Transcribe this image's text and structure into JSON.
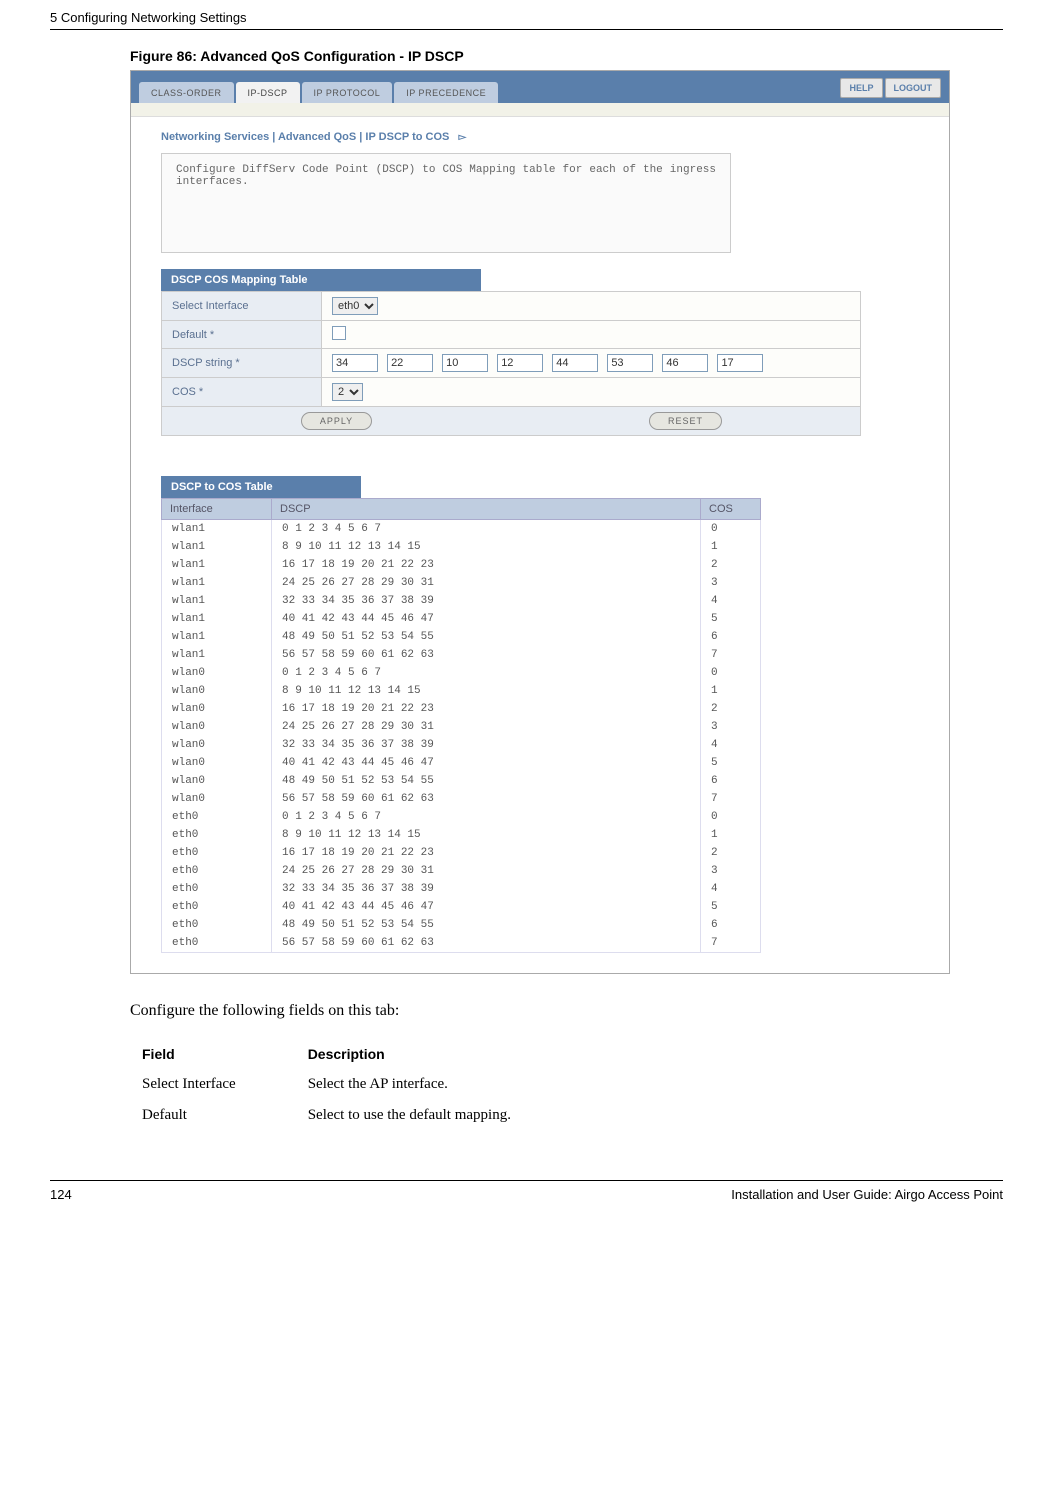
{
  "header": {
    "chapter": "5  Configuring Networking Settings"
  },
  "figure": {
    "caption": "Figure 86:     Advanced QoS Configuration - IP DSCP"
  },
  "ui": {
    "tabs": [
      "CLASS-ORDER",
      "IP-DSCP",
      "IP PROTOCOL",
      "IP PRECEDENCE"
    ],
    "active_tab_index": 1,
    "buttons": {
      "help": "HELP",
      "logout": "LOGOUT"
    },
    "breadcrumb": "Networking Services | Advanced QoS | IP DSCP to COS",
    "info_text": "Configure DiffServ Code Point (DSCP) to COS Mapping table for each of the ingress interfaces.",
    "panel1": {
      "title": "DSCP COS Mapping Table",
      "rows": {
        "select_interface": {
          "label": "Select Interface",
          "value": "eth0"
        },
        "default": {
          "label": "Default *",
          "checked": false
        },
        "dscp_string": {
          "label": "DSCP string *",
          "values": [
            "34",
            "22",
            "10",
            "12",
            "44",
            "53",
            "46",
            "17"
          ]
        },
        "cos": {
          "label": "COS *",
          "value": "2"
        }
      },
      "buttons": {
        "apply": "APPLY",
        "reset": "RESET"
      }
    },
    "panel2": {
      "title": "DSCP to COS Table",
      "headers": [
        "Interface",
        "DSCP",
        "COS"
      ],
      "rows": [
        {
          "iface": "wlan1",
          "dscp": "0 1 2 3 4 5 6 7",
          "cos": "0"
        },
        {
          "iface": "wlan1",
          "dscp": "8 9 10 11 12 13 14 15",
          "cos": "1"
        },
        {
          "iface": "wlan1",
          "dscp": "16 17 18 19 20 21 22 23",
          "cos": "2"
        },
        {
          "iface": "wlan1",
          "dscp": "24 25 26 27 28 29 30 31",
          "cos": "3"
        },
        {
          "iface": "wlan1",
          "dscp": "32 33 34 35 36 37 38 39",
          "cos": "4"
        },
        {
          "iface": "wlan1",
          "dscp": "40 41 42 43 44 45 46 47",
          "cos": "5"
        },
        {
          "iface": "wlan1",
          "dscp": "48 49 50 51 52 53 54 55",
          "cos": "6"
        },
        {
          "iface": "wlan1",
          "dscp": "56 57 58 59 60 61 62 63",
          "cos": "7"
        },
        {
          "iface": "wlan0",
          "dscp": "0 1 2 3 4 5 6 7",
          "cos": "0"
        },
        {
          "iface": "wlan0",
          "dscp": "8 9 10 11 12 13 14 15",
          "cos": "1"
        },
        {
          "iface": "wlan0",
          "dscp": "16 17 18 19 20 21 22 23",
          "cos": "2"
        },
        {
          "iface": "wlan0",
          "dscp": "24 25 26 27 28 29 30 31",
          "cos": "3"
        },
        {
          "iface": "wlan0",
          "dscp": "32 33 34 35 36 37 38 39",
          "cos": "4"
        },
        {
          "iface": "wlan0",
          "dscp": "40 41 42 43 44 45 46 47",
          "cos": "5"
        },
        {
          "iface": "wlan0",
          "dscp": "48 49 50 51 52 53 54 55",
          "cos": "6"
        },
        {
          "iface": "wlan0",
          "dscp": "56 57 58 59 60 61 62 63",
          "cos": "7"
        },
        {
          "iface": "eth0",
          "dscp": "0 1 2 3 4 5 6 7",
          "cos": "0"
        },
        {
          "iface": "eth0",
          "dscp": "8 9 10 11 12 13 14 15",
          "cos": "1"
        },
        {
          "iface": "eth0",
          "dscp": "16 17 18 19 20 21 22 23",
          "cos": "2"
        },
        {
          "iface": "eth0",
          "dscp": "24 25 26 27 28 29 30 31",
          "cos": "3"
        },
        {
          "iface": "eth0",
          "dscp": "32 33 34 35 36 37 38 39",
          "cos": "4"
        },
        {
          "iface": "eth0",
          "dscp": "40 41 42 43 44 45 46 47",
          "cos": "5"
        },
        {
          "iface": "eth0",
          "dscp": "48 49 50 51 52 53 54 55",
          "cos": "6"
        },
        {
          "iface": "eth0",
          "dscp": "56 57 58 59 60 61 62 63",
          "cos": "7"
        }
      ]
    }
  },
  "body_text": "Configure the following fields on this tab:",
  "field_table": {
    "headers": [
      "Field",
      "Description"
    ],
    "rows": [
      {
        "field": "Select Interface",
        "desc": "Select the AP interface."
      },
      {
        "field": "Default",
        "desc": "Select to use the default mapping."
      }
    ]
  },
  "footer": {
    "page": "124",
    "title": "Installation and User Guide: Airgo Access Point"
  }
}
